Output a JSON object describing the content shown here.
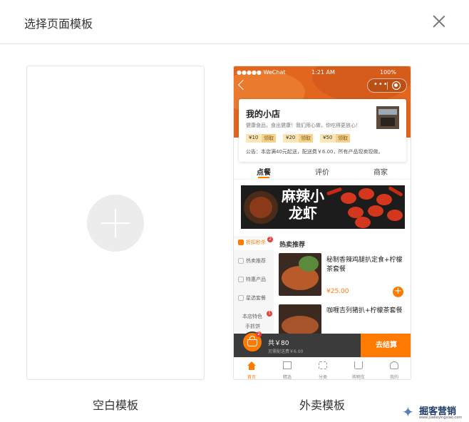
{
  "dialog": {
    "title": "选择页面模板"
  },
  "templates": {
    "blank": {
      "label": "空白模板"
    },
    "takeout": {
      "label": "外卖模板"
    }
  },
  "preview": {
    "status": {
      "carrier": "●●●●● WeChat",
      "time": "1:21 AM",
      "battery": "100%"
    },
    "shop": {
      "name": "我的小店",
      "desc": "健康食品，食出健康！我们用心做，你吃得更放心！",
      "coupons": [
        {
          "amount": "¥10",
          "action": "领取"
        },
        {
          "amount": "¥20",
          "action": "领取"
        },
        {
          "amount": "¥50",
          "action": "领取"
        }
      ],
      "notice": "公告：本店满40元起送，配送费￥6.00，所有产品现卖现做。"
    },
    "tabs": [
      "点餐",
      "评价",
      "商家"
    ],
    "banner": {
      "text": "麻辣小龙虾"
    },
    "categories": [
      {
        "label": "折扣秒杀",
        "badge": "2"
      },
      {
        "label": "热卖推荐"
      },
      {
        "label": "特惠产品"
      },
      {
        "label": "星选套餐"
      },
      {
        "label": "本店特色",
        "badge": "1"
      },
      {
        "label": "手抓饼"
      }
    ],
    "section_title": "热卖推荐",
    "items": [
      {
        "name": "秘制香辣鸡腿扒定食+柠檬茶套餐",
        "price": "¥25.00",
        "add": "+"
      },
      {
        "name": "咖喱吉列猪扒+柠檬茶套餐"
      }
    ],
    "cart": {
      "badge": "2",
      "total": "共￥80",
      "fee": "另需配送费￥6.00",
      "checkout": "去结算"
    },
    "bottom_nav": [
      "首页",
      "精选",
      "分类",
      "购物车",
      "我的"
    ]
  },
  "watermark": {
    "brand": "掘客营销",
    "url": "www.juekeyingxiao.com"
  },
  "colors": {
    "accent": "#ff7a00",
    "header_orange": "#e2661d"
  }
}
